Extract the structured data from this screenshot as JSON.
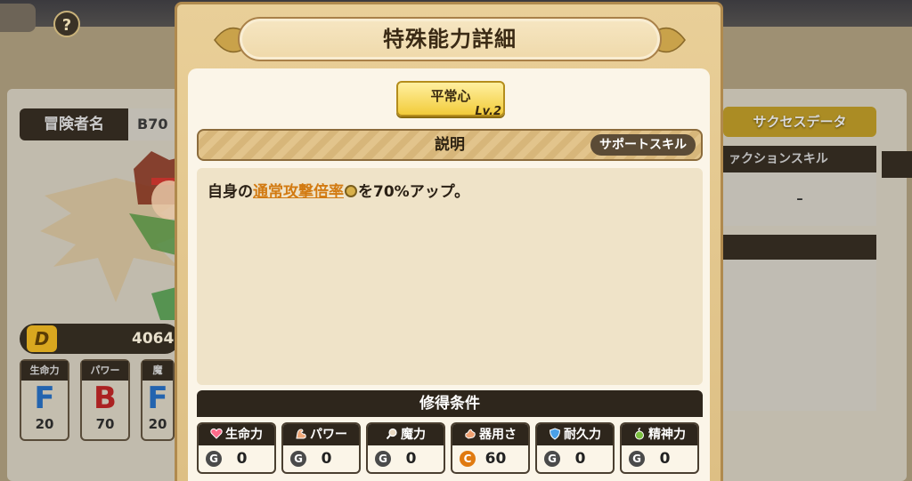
{
  "modal": {
    "title": "特殊能力詳細",
    "skill": {
      "name": "平常心",
      "level": "Lv.2"
    },
    "description_header": "説明",
    "skill_type": "サポートスキル",
    "description": {
      "prefix": "自身の",
      "keyword": "通常攻撃倍率",
      "suffix": "を70%アップ。"
    },
    "conditions_header": "修得条件",
    "conditions": [
      {
        "label": "生命力",
        "icon": "heart-icon",
        "grade": "G",
        "grade_color": "#4a4a4a",
        "value": "0"
      },
      {
        "label": "パワー",
        "icon": "arm-icon",
        "grade": "G",
        "grade_color": "#4a4a4a",
        "value": "0"
      },
      {
        "label": "魔力",
        "icon": "magnifier-icon",
        "grade": "G",
        "grade_color": "#4a4a4a",
        "value": "0"
      },
      {
        "label": "器用さ",
        "icon": "hand-icon",
        "grade": "C",
        "grade_color": "#e07a10",
        "value": "60"
      },
      {
        "label": "耐久力",
        "icon": "shield-icon",
        "grade": "G",
        "grade_color": "#4a4a4a",
        "value": "0"
      },
      {
        "label": "精神力",
        "icon": "spirit-icon",
        "grade": "G",
        "grade_color": "#4a4a4a",
        "value": "0"
      }
    ]
  },
  "background": {
    "help_label": "?",
    "adventurer_name_label": "冒険者名",
    "adventurer_name_value": "B70",
    "rank_badge": "D",
    "rank_value": "4064",
    "stats": [
      {
        "label": "生命力",
        "grade": "F",
        "color": "#2b7ad6",
        "value": "20"
      },
      {
        "label": "パワー",
        "grade": "B",
        "color": "#d12a2a",
        "value": "70"
      },
      {
        "label": "魔",
        "grade": "F",
        "color": "#2b7ad6",
        "value": "20"
      }
    ],
    "success_data_button": "サクセスデータ",
    "action_skill_label": "ァクションスキル",
    "action_skill_value": "-"
  }
}
